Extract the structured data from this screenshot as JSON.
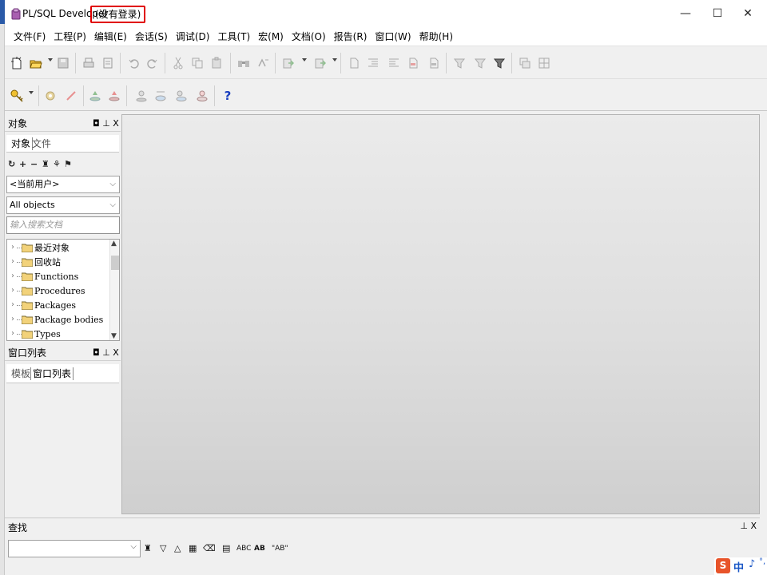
{
  "window": {
    "app_title": "PL/SQL Developer",
    "login_status": "(没有登录)",
    "minimize": "—",
    "maximize": "☐",
    "close": "✕"
  },
  "menu": [
    "文件(F)",
    "工程(P)",
    "编辑(E)",
    "会话(S)",
    "调试(D)",
    "工具(T)",
    "宏(M)",
    "文档(O)",
    "报告(R)",
    "窗口(W)",
    "帮助(H)"
  ],
  "toolbar2": {
    "help_icon": "?"
  },
  "object_panel": {
    "title": "对象",
    "controls": "◘ ⊥ X",
    "tabs": [
      "对象",
      "文件"
    ],
    "user_select": "<当前用户>",
    "filter_select": "All objects",
    "search_placeholder": "输入搜索文档",
    "tree": [
      "最近对象",
      "回收站",
      "Functions",
      "Procedures",
      "Packages",
      "Package bodies",
      "Types"
    ]
  },
  "window_list_panel": {
    "title": "窗口列表",
    "controls": "◘ ⊥ X",
    "tabs": [
      "模板",
      "窗口列表"
    ]
  },
  "find_panel": {
    "title": "查找",
    "controls": "⊥ X",
    "combo_value": "",
    "abc_label": "ABC",
    "ab_label": "AB",
    "quote_ab_label": "\"AB\""
  },
  "ime": {
    "logo": "S",
    "mode": "中",
    "moon": "♪",
    "punct": "°,"
  },
  "colors": {
    "login_highlight": "#e00000",
    "help_icon": "#1a3fbf",
    "ime_accent": "#1a56c6"
  }
}
